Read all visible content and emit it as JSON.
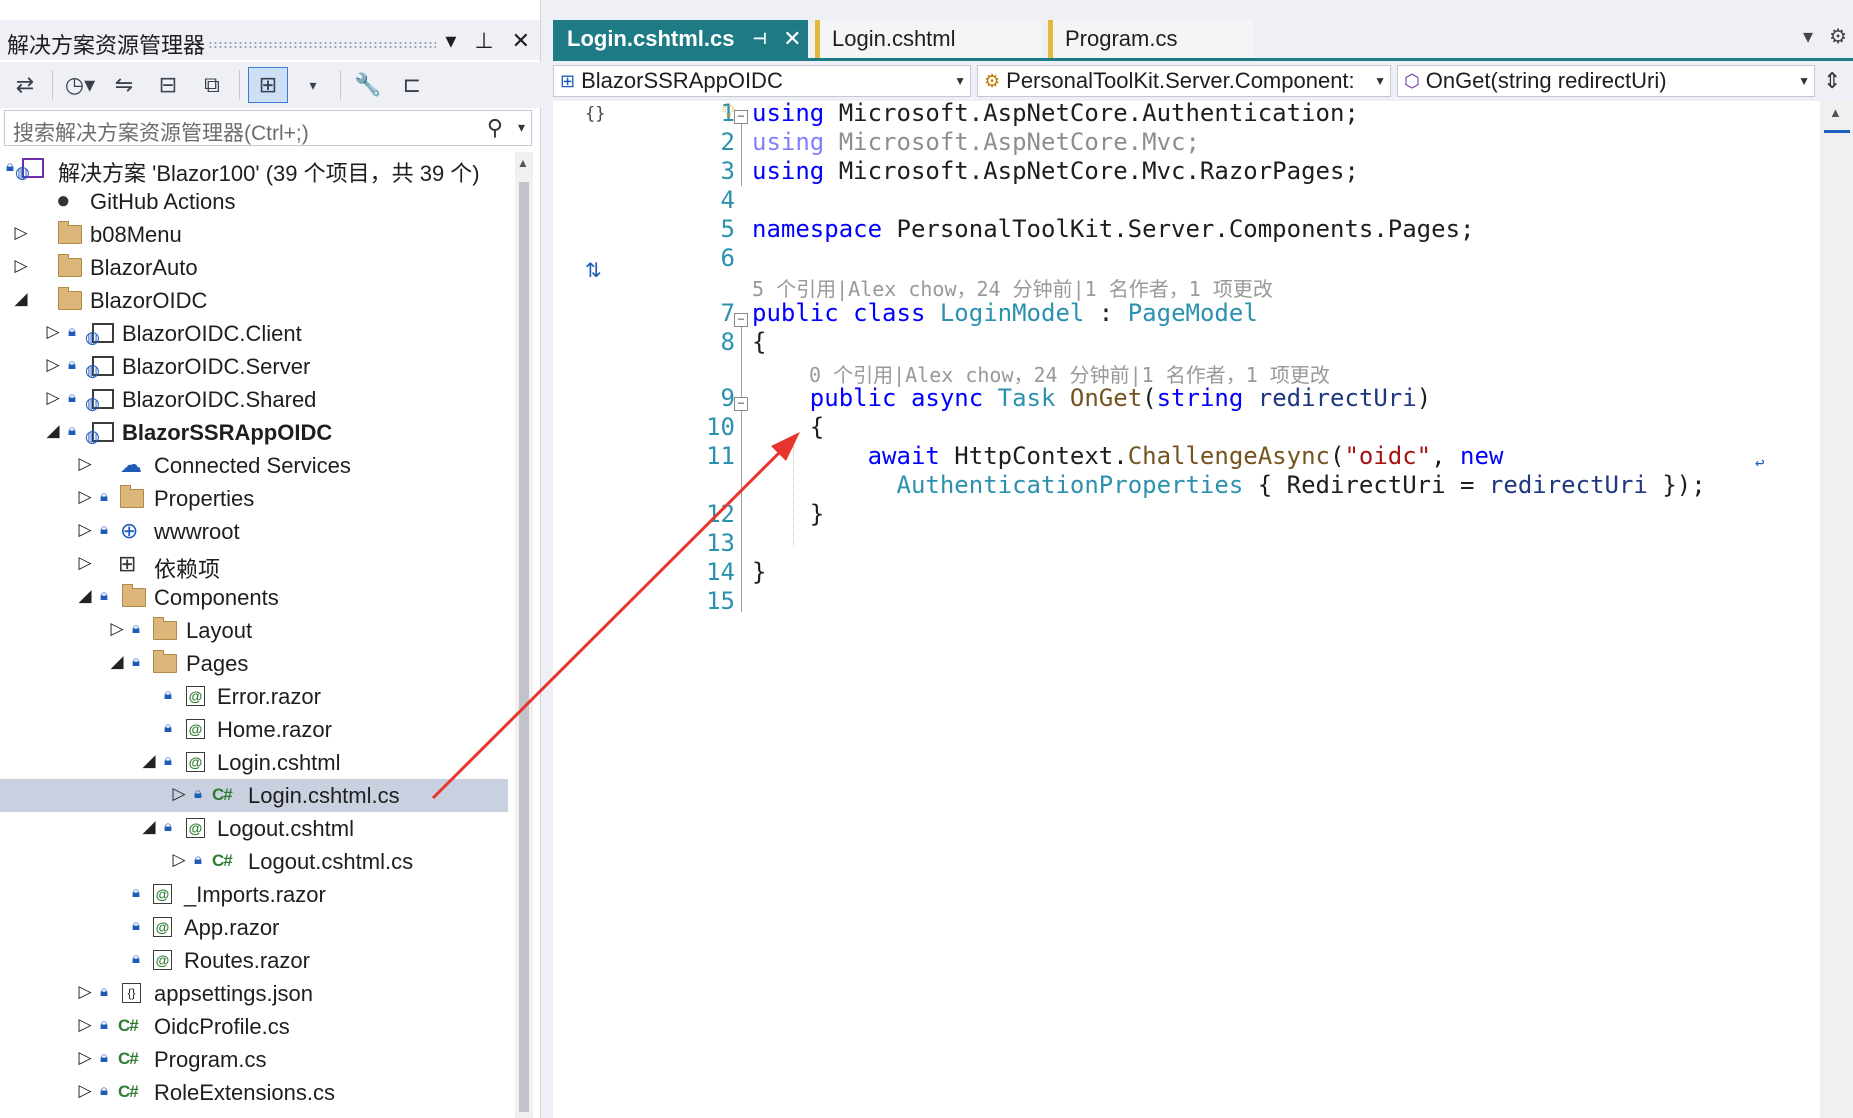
{
  "explorer": {
    "title": "解决方案资源管理器",
    "search_placeholder": "搜索解决方案资源管理器(Ctrl+;)",
    "tree": [
      {
        "label": "解决方案 'Blazor100' (39 个项目，共 39 个)",
        "icon": "solution-icon"
      },
      {
        "label": "GitHub Actions",
        "icon": "github-icon"
      },
      {
        "label": "b08Menu",
        "icon": "folder-icon"
      },
      {
        "label": "BlazorAuto",
        "icon": "folder-icon"
      },
      {
        "label": "BlazorOIDC",
        "icon": "folder-icon"
      },
      {
        "label": "BlazorOIDC.Client",
        "icon": "project-icon"
      },
      {
        "label": "BlazorOIDC.Server",
        "icon": "project-icon"
      },
      {
        "label": "BlazorOIDC.Shared",
        "icon": "project-icon"
      },
      {
        "label": "BlazorSSRAppOIDC",
        "icon": "project-icon"
      },
      {
        "label": "Connected Services",
        "icon": "connected-services-icon"
      },
      {
        "label": "Properties",
        "icon": "properties-icon"
      },
      {
        "label": "wwwroot",
        "icon": "globe-icon"
      },
      {
        "label": "依赖项",
        "icon": "dependencies-icon"
      },
      {
        "label": "Components",
        "icon": "folder-icon"
      },
      {
        "label": "Layout",
        "icon": "folder-icon"
      },
      {
        "label": "Pages",
        "icon": "folder-icon"
      },
      {
        "label": "Error.razor",
        "icon": "razor-file-icon"
      },
      {
        "label": "Home.razor",
        "icon": "razor-file-icon"
      },
      {
        "label": "Login.cshtml",
        "icon": "razor-file-icon"
      },
      {
        "label": "Login.cshtml.cs",
        "icon": "csharp-file-icon"
      },
      {
        "label": "Logout.cshtml",
        "icon": "razor-file-icon"
      },
      {
        "label": "Logout.cshtml.cs",
        "icon": "csharp-file-icon"
      },
      {
        "label": "_Imports.razor",
        "icon": "razor-file-icon"
      },
      {
        "label": "App.razor",
        "icon": "razor-file-icon"
      },
      {
        "label": "Routes.razor",
        "icon": "razor-file-icon"
      },
      {
        "label": "appsettings.json",
        "icon": "json-file-icon"
      },
      {
        "label": "OidcProfile.cs",
        "icon": "csharp-file-icon"
      },
      {
        "label": "Program.cs",
        "icon": "csharp-file-icon"
      },
      {
        "label": "RoleExtensions.cs",
        "icon": "csharp-file-icon"
      }
    ]
  },
  "tabs": [
    {
      "label": "Login.cshtml.cs",
      "active": true
    },
    {
      "label": "Login.cshtml",
      "active": false
    },
    {
      "label": "Program.cs",
      "active": false
    }
  ],
  "navbar": {
    "project": "BlazorSSRAppOIDC",
    "type": "PersonalToolKit.Server.Component:",
    "member": "OnGet(string redirectUri)"
  },
  "code": {
    "line_numbers": [
      "1",
      "2",
      "3",
      "4",
      "5",
      "6",
      "7",
      "8",
      "9",
      "10",
      "11",
      "12",
      "13",
      "14",
      "15"
    ],
    "codelens_class": "5 个引用|Alex chow，24 分钟前|1 名作者，1 项更改",
    "codelens_method": "0 个引用|Alex chow，24 分钟前|1 名作者，1 项更改",
    "t": {
      "using": "using",
      "ns1": " Microsoft.AspNetCore.Authentication;",
      "ns2": " Microsoft.AspNetCore.Mvc;",
      "ns3": " Microsoft.AspNetCore.Mvc.RazorPages;",
      "namespace": "namespace",
      "ns_name": " PersonalToolKit.Server.Components.Pages;",
      "public": "public",
      "class": "class",
      "class_name": "LoginModel",
      "colon": " : ",
      "base": "PageModel",
      "open": "{",
      "close": "}",
      "async": "async",
      "task": "Task",
      "method": "OnGet",
      "paren_open": "(",
      "string_kw": "string",
      "param": "redirectUri",
      "paren_close": ")",
      "await": "await",
      "httpctx": " HttpContext.",
      "challenge": "ChallengeAsync",
      "oidc": "\"oidc\"",
      "comma": ", ",
      "new": "new",
      "authprops": "AuthenticationProperties",
      "brace_redirect": " { RedirectUri = ",
      "end": " });"
    }
  },
  "annotation": {
    "color": "#e8342d"
  }
}
